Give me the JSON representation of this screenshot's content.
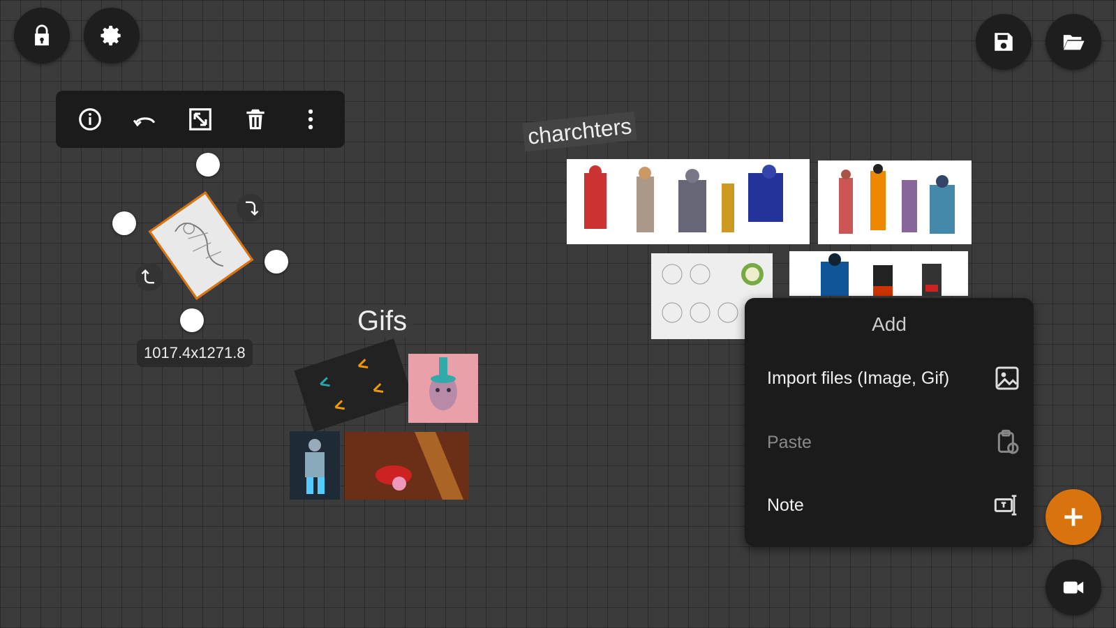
{
  "top_left": {
    "lock_icon": "lock-icon",
    "settings_icon": "gear-icon"
  },
  "top_right": {
    "save_icon": "save-icon",
    "open_icon": "folder-open-icon"
  },
  "toolbar": {
    "items": [
      "info-icon",
      "undo-icon",
      "resize-icon",
      "trash-icon",
      "more-vertical-icon"
    ]
  },
  "selection": {
    "dimensions": "1017.4x1271.8"
  },
  "canvas": {
    "labels": {
      "characters": "charchters",
      "gifs": "Gifs"
    }
  },
  "add_menu": {
    "title": "Add",
    "items": [
      {
        "label": "Import files (Image, Gif)",
        "icon": "image-icon",
        "enabled": true
      },
      {
        "label": "Paste",
        "icon": "clipboard-icon",
        "enabled": false
      },
      {
        "label": "Note",
        "icon": "note-icon",
        "enabled": true
      }
    ]
  },
  "fab": {
    "add_icon": "plus-icon",
    "record_icon": "video-camera-icon"
  },
  "colors": {
    "accent": "#d9730d",
    "canvas_bg": "#3b3b3b",
    "panel_bg": "#1b1b1b"
  }
}
